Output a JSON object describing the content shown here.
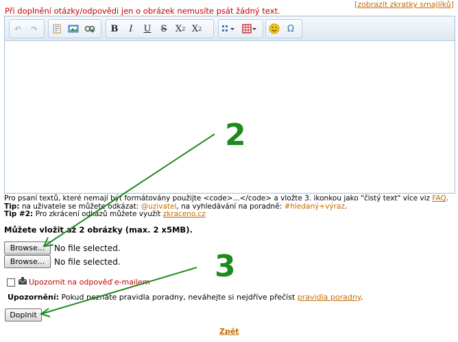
{
  "notice": "Při doplnění otázky/odpovědi jen o obrázek nemusíte psát žádný text.",
  "smiley_link": "zobrazit zkratky smajlíků",
  "info": {
    "line1_pre": "Pro psaní textů, které nemají být formátovány použijte <code>...</code> a vložte 3. ikonkou jako \"čistý text\" více viz ",
    "line1_link": "FAQ",
    "line2_label": "Tip:",
    "line2_a": " na uživatele se můžete odkázat: ",
    "line2_mention": "@uzivatel",
    "line2_b": ", na vyhledávání na poradně: ",
    "line2_search": "#hledaný+výraz",
    "line3_label": "Tip #2:",
    "line3_a": " Pro zkrácení odkazů můžete využít ",
    "line3_link": "zkraceno.cz"
  },
  "attachments": {
    "title": "Můžete vložit až 2 obrázky (max. 2 x5MB).",
    "browse_label": "Browse...",
    "file_status": "No file selected."
  },
  "notify_label": "Upozornit na odpověď e-mailem",
  "warning": {
    "label": "Upozornění:",
    "text": " Pokud neznáte pravidla poradny, neváhejte si nejdříve přečíst ",
    "link": "pravidla poradny",
    "end": "."
  },
  "submit_label": "Doplnit",
  "back_label": "Zpět",
  "annotations": {
    "two": "2",
    "three": "3"
  },
  "colors": {
    "annotation_green": "#1d8a1d",
    "link_orange": "#c26a00",
    "notice_red": "#c00000"
  }
}
